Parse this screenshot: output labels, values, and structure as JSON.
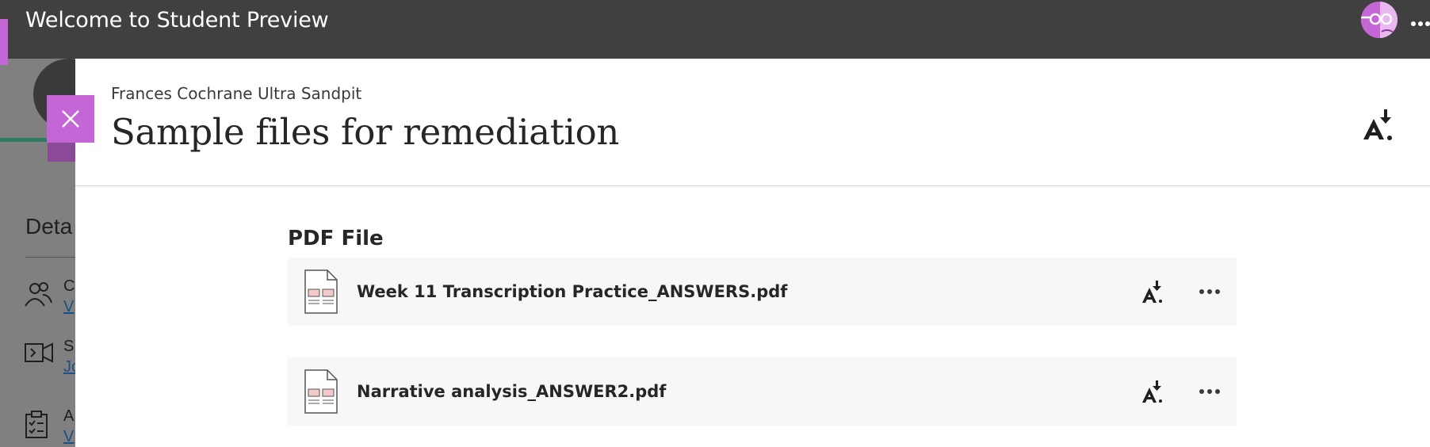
{
  "topbar": {
    "title": "Welcome to Student Preview",
    "more_icon": "more-horizontal-icon",
    "accent_color": "#c466d6"
  },
  "background_page": {
    "details_label": "Deta",
    "rows": [
      {
        "icon": "people-icon",
        "line1": "C",
        "line2": "V"
      },
      {
        "icon": "video-icon",
        "line1": "S",
        "line2": "Jo"
      },
      {
        "icon": "clipboard-icon",
        "line1": "A",
        "line2": "V"
      }
    ]
  },
  "panel": {
    "close_icon": "close-icon",
    "course_name": "Frances Cochrane Ultra Sandpit",
    "title": "Sample files for remediation",
    "header_icon": "ally-alternative-formats-icon",
    "section_heading": "PDF File",
    "files": [
      {
        "name": "Week 11 Transcription Practice_ANSWERS.pdf",
        "icon": "pdf-file-icon"
      },
      {
        "name": "Narrative analysis_ANSWER2.pdf",
        "icon": "pdf-file-icon"
      }
    ]
  },
  "colors": {
    "topbar_bg": "#404040",
    "accent": "#c466d6",
    "card_bg": "#f7f7f7",
    "link": "#1c4f82"
  }
}
